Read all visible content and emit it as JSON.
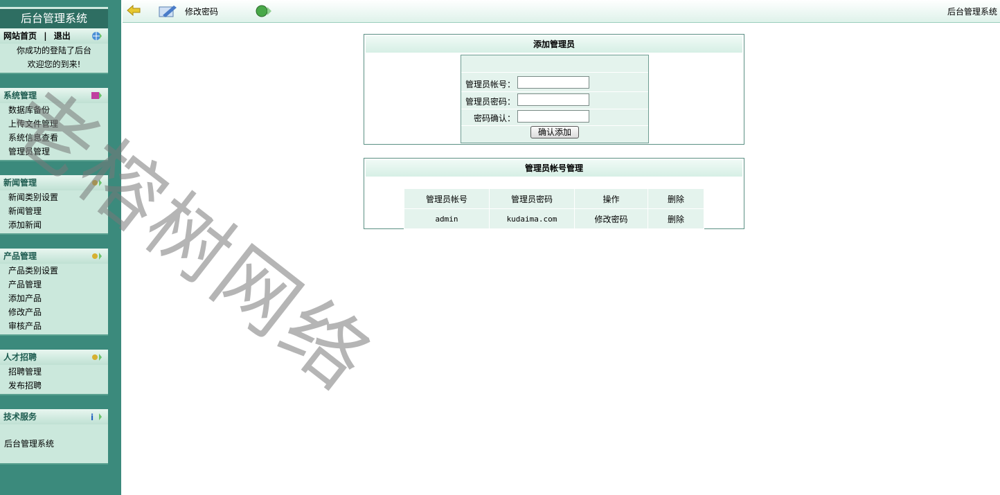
{
  "sidebar": {
    "title": "后台管理系统",
    "top_panel": {
      "home_link": "网站首页",
      "separator": "|",
      "logout_link": "退出",
      "welcome_line1": "你成功的登陆了后台",
      "welcome_line2": "欢迎您的到来!"
    },
    "sections": [
      {
        "title": "系统管理",
        "items": [
          "数据库备份",
          "上传文件管理",
          "系统信息查看",
          "管理员管理"
        ]
      },
      {
        "title": "新闻管理",
        "items": [
          "新闻类别设置",
          "新闻管理",
          "添加新闻"
        ]
      },
      {
        "title": "产品管理",
        "items": [
          "产品类别设置",
          "产品管理",
          "添加产品",
          "修改产品",
          "审核产品"
        ]
      },
      {
        "title": "人才招聘",
        "items": [
          "招聘管理",
          "发布招聘"
        ]
      },
      {
        "title": "技术服务",
        "items": [
          "后台管理系统"
        ]
      }
    ]
  },
  "toolbar": {
    "change_password": "修改密码",
    "system_name": "后台管理系统"
  },
  "add_admin": {
    "title": "添加管理员",
    "account_label": "管理员帐号：",
    "password_label": "管理员密码：",
    "confirm_label": "密码确认：",
    "submit_label": "确认添加"
  },
  "account_manage": {
    "title": "管理员帐号管理",
    "headers": [
      "管理员帐号",
      "管理员密码",
      "操作",
      "删除"
    ],
    "rows": [
      [
        "admin",
        "kudaima.com",
        "修改密码",
        "删除"
      ]
    ]
  },
  "watermark": "老榕树网络"
}
